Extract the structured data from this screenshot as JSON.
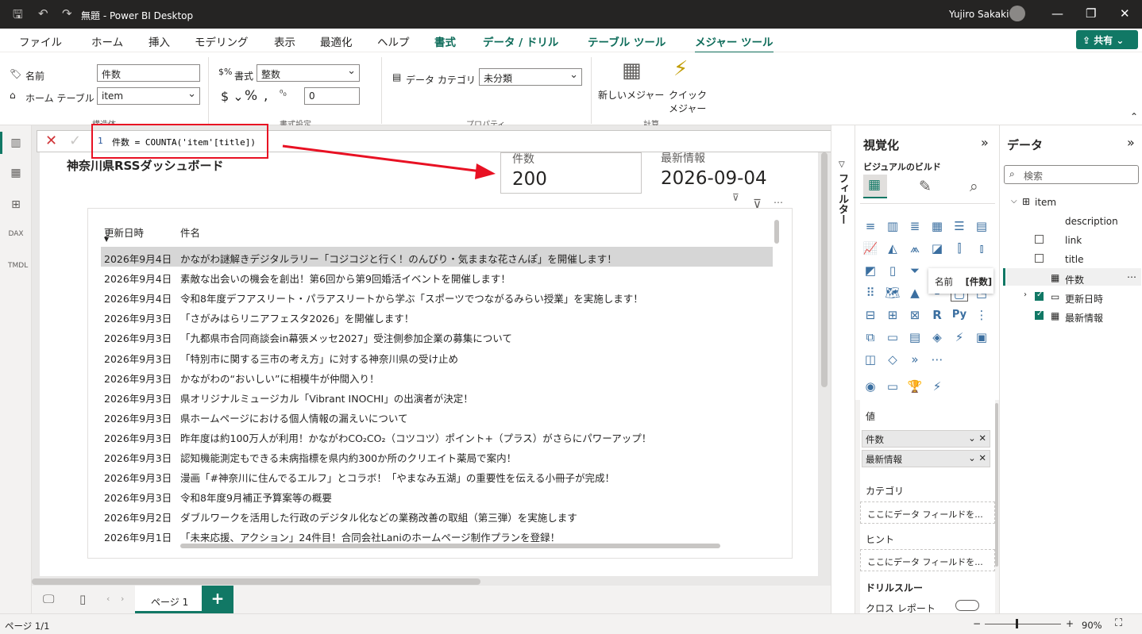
{
  "titlebar": {
    "doc": "無題 - Power BI Desktop",
    "user": "Yujiro Sakaki"
  },
  "menu": {
    "items": [
      "ファイル",
      "ホーム",
      "挿入",
      "モデリング",
      "表示",
      "最適化",
      "ヘルプ"
    ],
    "context": [
      "書式",
      "データ / ドリル",
      "テーブル ツール",
      "メジャー ツール"
    ],
    "share": "共有"
  },
  "ribbon": {
    "name_label": "名前",
    "name_value": "件数",
    "home_table_label": "ホーム テーブル",
    "home_table_value": "item",
    "structure_group": "構造体",
    "format_label": "書式",
    "format_value": "整数",
    "decimals_value": "0",
    "format_group": "書式設定",
    "data_category_label": "データ カテゴリ",
    "data_category_value": "未分類",
    "properties_group": "プロパティ",
    "new_measure": "新しいメジャー",
    "quick_measure_1": "クイック",
    "quick_measure_2": "メジャー",
    "calc_group": "計算"
  },
  "formula": {
    "line": "1",
    "text": "件数 = COUNTA('item'[title])"
  },
  "report": {
    "title": "神奈川県RSSダッシュボード",
    "card1_label": "件数",
    "card1_value": "200",
    "card2_label": "最新情報",
    "card2_value": "2026-09-04",
    "table_headers": [
      "更新日時",
      "件名"
    ],
    "rows": [
      {
        "date": "2026年9月4日",
        "name": "かながわ謎解きデジタルラリー「コジコジと行く！のんびり・気ままな花さんぽ」を開催します！"
      },
      {
        "date": "2026年9月4日",
        "name": "素敵な出会いの機会を創出！第6回から第9回婚活イベントを開催します！"
      },
      {
        "date": "2026年9月4日",
        "name": "令和8年度デフアスリート・パラアスリートから学ぶ「スポーツでつながるみらい授業」を実施します！"
      },
      {
        "date": "2026年9月3日",
        "name": "「さがみはらリニアフェスタ2026」を開催します！"
      },
      {
        "date": "2026年9月3日",
        "name": "「九都県市合同商談会in幕張メッセ2027」受注側参加企業の募集について"
      },
      {
        "date": "2026年9月3日",
        "name": "「特別市に関する三市の考え方」に対する神奈川県の受け止め"
      },
      {
        "date": "2026年9月3日",
        "name": "かながわの“おいしい”に相模牛が仲間入り！"
      },
      {
        "date": "2026年9月3日",
        "name": "県オリジナルミュージカル「Vibrant INOCHI」の出演者が決定！"
      },
      {
        "date": "2026年9月3日",
        "name": "県ホームページにおける個人情報の漏えいについて"
      },
      {
        "date": "2026年9月3日",
        "name": "昨年度は約100万人が利用！かながわCO₂CO₂（コツコツ）ポイント+（プラス）がさらにパワーアップ！"
      },
      {
        "date": "2026年9月3日",
        "name": "認知機能測定もできる未病指標を県内約300か所のクリエイト薬局で案内！"
      },
      {
        "date": "2026年9月3日",
        "name": "漫画「#神奈川に住んでるエルフ」とコラボ！「やまなみ五湖」の重要性を伝える小冊子が完成！"
      },
      {
        "date": "2026年9月3日",
        "name": "令和8年度9月補正予算案等の概要"
      },
      {
        "date": "2026年9月2日",
        "name": "ダブルワークを活用した行政のデジタル化などの業務改善の取組（第三弾）を実施します"
      },
      {
        "date": "2026年9月1日",
        "name": "「未来応援、アクション」24件目！合同会社Laniのホームページ制作プランを登録！"
      }
    ]
  },
  "filters": {
    "label": "フィルター"
  },
  "viz": {
    "title": "視覚化",
    "build": "ビジュアルのビルド",
    "tooltip_label": "名前",
    "tooltip_value": "[件数]",
    "values_head": "値",
    "values": [
      "件数",
      "最新情報"
    ],
    "category_head": "カテゴリ",
    "category_drop": "ここにデータ フィールドを...",
    "hint_head": "ヒント",
    "hint_drop": "ここにデータ フィールドを...",
    "drill_head": "ドリルスルー",
    "cross_report": "クロス レポート"
  },
  "data": {
    "title": "データ",
    "search_placeholder": "検索",
    "table": "item",
    "fields": [
      "description",
      "link",
      "title",
      "件数",
      "更新日時",
      "最新情報"
    ]
  },
  "tabs": {
    "page": "ページ 1"
  },
  "status": {
    "page": "ページ 1/1",
    "zoom": "90%"
  }
}
